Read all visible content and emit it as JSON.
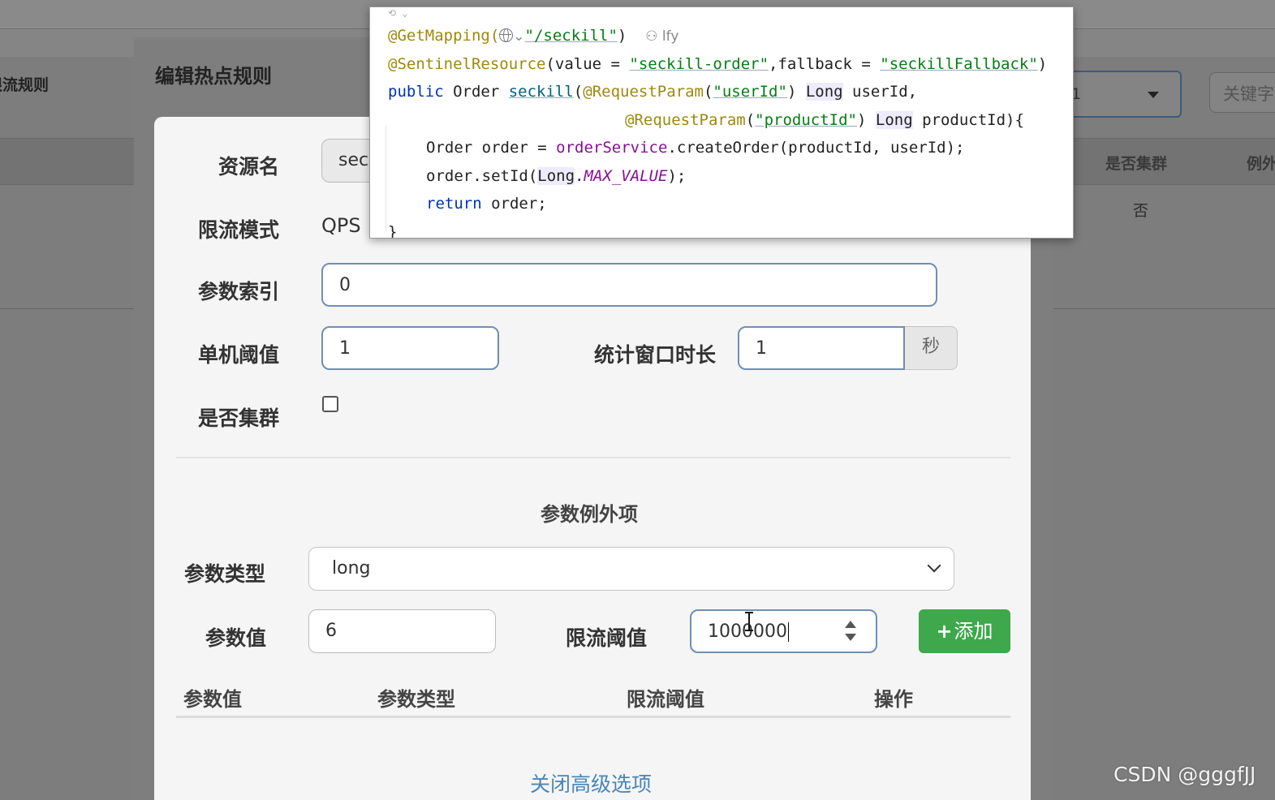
{
  "background": {
    "page_title": "限流规则",
    "filter_select_value": "1",
    "keyword_placeholder": "关键字",
    "columns": {
      "cluster": "是否集群",
      "exception": "例外"
    },
    "row": {
      "cluster_value": "否"
    }
  },
  "modal": {
    "title": "编辑热点规则",
    "resource_label": "资源名",
    "resource_value": "sec",
    "mode_label": "限流模式",
    "mode_value": "QPS",
    "param_index_label": "参数索引",
    "param_index_value": "0",
    "threshold_label": "单机阈值",
    "threshold_value": "1",
    "window_label": "统计窗口时长",
    "window_value": "1",
    "window_unit": "秒",
    "cluster_label": "是否集群",
    "cluster_checked": false,
    "exceptions": {
      "section_title": "参数例外项",
      "type_label": "参数类型",
      "type_selected": "long",
      "value_label": "参数值",
      "value_value": "6",
      "limit_label": "限流阈值",
      "limit_value": "1000000",
      "add_button": "添加",
      "table_headers": [
        "参数值",
        "参数类型",
        "限流阈值",
        "操作"
      ]
    },
    "close_advanced_link": "关闭高级选项"
  },
  "code_popup": {
    "author": "lfy",
    "lines": {
      "l1_ann": "@GetMapping(",
      "l1_str": "\"/seckill\"",
      "l1_end": ")",
      "l2_ann": "@SentinelResource",
      "l2_a": "(value = ",
      "l2_s1": "\"seckill-order\"",
      "l2_b": ",fallback = ",
      "l2_s2": "\"seckillFallback\"",
      "l2_c": ")",
      "l3_kw": "public",
      "l3_a": " Order ",
      "l3_fn": "seckill",
      "l3_b": "(",
      "l3_ann": "@RequestParam",
      "l3_c": "(",
      "l3_s": "\"userId\"",
      "l3_d": ") ",
      "l3_t": "Long",
      "l3_e": " userId,",
      "l4_ann": "@RequestParam",
      "l4_a": "(",
      "l4_s": "\"productId\"",
      "l4_b": ") ",
      "l4_t": "Long",
      "l4_c": " productId){",
      "l5_a": "Order order = ",
      "l5_svc": "orderService",
      "l5_b": ".createOrder(productId, userId);",
      "l6_a": "order.setId(",
      "l6_t": "Long",
      "l6_b": ".",
      "l6_f": "MAX_VALUE",
      "l6_c": ");",
      "l7_kw": "return",
      "l7_a": " order;",
      "l8": "}"
    }
  },
  "watermark": "CSDN @gggfJJ"
}
